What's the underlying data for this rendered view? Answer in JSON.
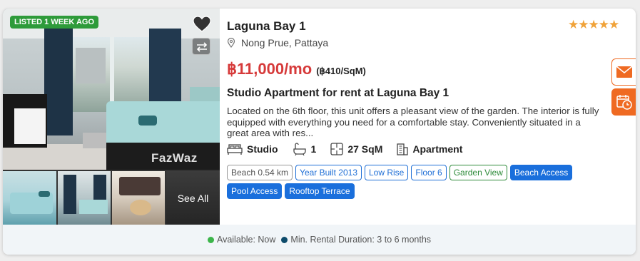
{
  "listing": {
    "badge": "LISTED 1 WEEK AGO",
    "watermark": "FazWaz",
    "see_all_label": "See All",
    "title": "Laguna Bay 1",
    "rating_stars": "★★★★★",
    "location": "Nong Prue, Pattaya",
    "price": "฿11,000/mo",
    "price_per_sqm": "(฿410/SqM)",
    "headline": "Studio Apartment for rent at Laguna Bay 1",
    "description": "Located on the 6th floor, this unit offers a pleasant view of the garden. The interior is fully equipped with everything you need for a comfortable stay. Conveniently situated in a great area with res...",
    "features": {
      "bedroom": "Studio",
      "bathrooms": "1",
      "area": "27 SqM",
      "property_type": "Apartment"
    },
    "tags": [
      {
        "label": "Beach 0.54 km",
        "style": "gray"
      },
      {
        "label": "Year Built 2013",
        "style": "blue"
      },
      {
        "label": "Low Rise",
        "style": "blue"
      },
      {
        "label": "Floor 6",
        "style": "blue"
      },
      {
        "label": "Garden View",
        "style": "green"
      },
      {
        "label": "Beach Access",
        "style": "solid"
      },
      {
        "label": "Pool Access",
        "style": "solid"
      },
      {
        "label": "Rooftop Terrace",
        "style": "solid"
      }
    ]
  },
  "footer": {
    "availability": "Available: Now",
    "rental_duration": "Min. Rental Duration: 3 to 6 months"
  },
  "colors": {
    "price": "#d63a3a",
    "accent_orange": "#ef6a22",
    "tag_blue": "#1a6fdc",
    "badge_green": "#2e9b3a",
    "available_dot": "#3cb54a",
    "duration_dot": "#0d4b6b",
    "stars": "#f0a33a"
  },
  "icons": {
    "favorite": "heart-icon",
    "compare": "compare-icon",
    "location": "map-pin-icon",
    "bed": "bed-icon",
    "bath": "bathtub-icon",
    "area": "floorplan-icon",
    "type": "building-icon",
    "email": "mail-icon",
    "schedule": "calendar-clock-icon"
  }
}
